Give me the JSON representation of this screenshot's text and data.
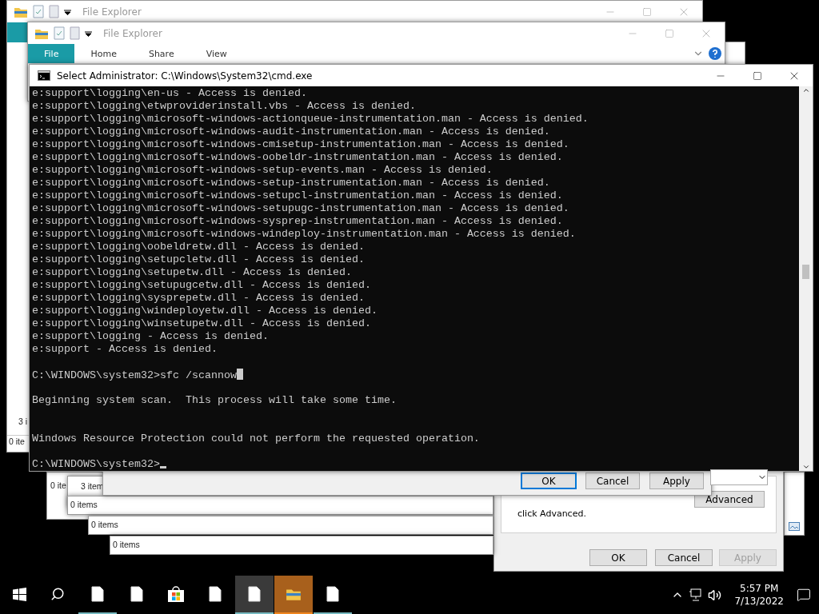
{
  "explorer_windows": [
    {
      "title": "File Explorer",
      "status": [
        "3 i",
        "0 ite"
      ]
    },
    {
      "title": "File Explorer",
      "tabs": [
        {
          "label": "File",
          "selected": true
        },
        {
          "label": "Home",
          "selected": false
        },
        {
          "label": "Share",
          "selected": false
        },
        {
          "label": "View",
          "selected": false
        }
      ]
    }
  ],
  "console": {
    "title": "Select Administrator: C:\\Windows\\System32\\cmd.exe",
    "lines": [
      {
        "text": "e:support\\logging\\en-us - Access is denied."
      },
      {
        "text": "e:support\\logging\\etwproviderinstall.vbs - Access is denied."
      },
      {
        "text": "e:support\\logging\\microsoft-windows-actionqueue-instrumentation.man - Access is denied."
      },
      {
        "text": "e:support\\logging\\microsoft-windows-audit-instrumentation.man - Access is denied."
      },
      {
        "text": "e:support\\logging\\microsoft-windows-cmisetup-instrumentation.man - Access is denied."
      },
      {
        "text": "e:support\\logging\\microsoft-windows-oobeldr-instrumentation.man - Access is denied."
      },
      {
        "text": "e:support\\logging\\microsoft-windows-setup-events.man - Access is denied."
      },
      {
        "text": "e:support\\logging\\microsoft-windows-setup-instrumentation.man - Access is denied."
      },
      {
        "text": "e:support\\logging\\microsoft-windows-setupcl-instrumentation.man - Access is denied."
      },
      {
        "text": "e:support\\logging\\microsoft-windows-setupugc-instrumentation.man - Access is denied."
      },
      {
        "text": "e:support\\logging\\microsoft-windows-sysprep-instrumentation.man - Access is denied."
      },
      {
        "text": "e:support\\logging\\microsoft-windows-windeploy-instrumentation.man - Access is denied."
      },
      {
        "text": "e:support\\logging\\oobeldretw.dll - Access is denied."
      },
      {
        "text": "e:support\\logging\\setupcletw.dll - Access is denied."
      },
      {
        "text": "e:support\\logging\\setupetw.dll - Access is denied."
      },
      {
        "text": "e:support\\logging\\setupugcetw.dll - Access is denied."
      },
      {
        "text": "e:support\\logging\\sysprepetw.dll - Access is denied."
      },
      {
        "text": "e:support\\logging\\windeployetw.dll - Access is denied."
      },
      {
        "text": "e:support\\logging\\winsetupetw.dll - Access is denied."
      },
      {
        "text": "e:support\\logging - Access is denied."
      },
      {
        "text": "e:support - Access is denied."
      },
      {
        "kind": "blank"
      },
      {
        "kind": "command",
        "text": "C:\\WINDOWS\\system32>sfc /scannow"
      },
      {
        "kind": "blank"
      },
      {
        "text": "Beginning system scan.  This process will take some time."
      },
      {
        "kind": "blank"
      },
      {
        "kind": "blank"
      },
      {
        "text": "Windows Resource Protection could not perform the requested operation."
      },
      {
        "kind": "blank"
      },
      {
        "kind": "prompt",
        "text": "C:\\WINDOWS\\system32>"
      }
    ]
  },
  "background_windows": [
    {
      "status": "0 ite"
    },
    {
      "status": "3 item"
    },
    {
      "status": "0 items"
    },
    {
      "status": "0 items"
    },
    {
      "status": "0 items"
    }
  ],
  "dialog": {
    "buttons": [
      {
        "label": "OK",
        "default": true,
        "disabled": false
      },
      {
        "label": "Cancel",
        "default": false,
        "disabled": false
      },
      {
        "label": "Apply",
        "default": false,
        "disabled": false
      }
    ]
  },
  "properties_dialog": {
    "note": "click Advanced.",
    "advanced_button": "Advanced",
    "buttons": [
      {
        "label": "OK",
        "disabled": false
      },
      {
        "label": "Cancel",
        "disabled": false
      },
      {
        "label": "Apply",
        "disabled": true
      }
    ]
  },
  "taskbar": {
    "items": [
      {
        "kind": "file",
        "running": true,
        "selected": false,
        "flashing": false
      },
      {
        "kind": "file",
        "running": false,
        "selected": false,
        "flashing": false
      },
      {
        "kind": "store",
        "running": false,
        "selected": false,
        "flashing": false
      },
      {
        "kind": "file",
        "running": false,
        "selected": false,
        "flashing": false
      },
      {
        "kind": "file",
        "running": true,
        "selected": true,
        "flashing": false
      },
      {
        "kind": "folder",
        "running": true,
        "selected": false,
        "flashing": true
      },
      {
        "kind": "file",
        "running": true,
        "selected": false,
        "flashing": false
      }
    ],
    "time": "5:57 PM",
    "date": "7/13/2022"
  }
}
